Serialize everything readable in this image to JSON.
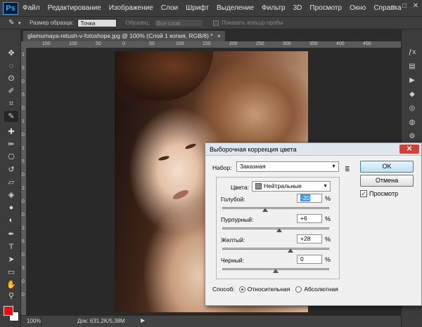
{
  "app": {
    "logo": "Ps"
  },
  "menu": [
    "Файл",
    "Редактирование",
    "Изображение",
    "Слои",
    "Шрифт",
    "Выделение",
    "Фильтр",
    "3D",
    "Просмотр",
    "Окно",
    "Справка"
  ],
  "window_controls": {
    "minimize": "–",
    "maximize": "□",
    "close": "✕"
  },
  "options_bar": {
    "tool_icon": "eyedropper-icon",
    "sample_size_label": "Размер образца:",
    "sample_size_value": "Точка",
    "sample_label": "Образец:",
    "sample_value": "Все слои",
    "show_ring_label": "Показать кольцо пробы"
  },
  "document": {
    "tab_title": "glamurnaya-retush-v-fotoshope.jpg @ 100% (Слой 1 копия, RGB/8) *",
    "tab_close": "×"
  },
  "ruler": {
    "h_ticks": [
      "150",
      "100",
      "50",
      "0",
      "50",
      "100",
      "150",
      "200",
      "250",
      "300",
      "350",
      "400",
      "450"
    ],
    "v_ticks": [
      "1",
      "5",
      "0",
      "5",
      "0",
      "1",
      "0",
      "1",
      "5",
      "0",
      "2",
      "0",
      "0",
      "2",
      "5",
      "0",
      "3",
      "0",
      "0"
    ]
  },
  "status_bar": {
    "zoom": "100%",
    "doc_info": "Док: 631,2K/5,38M",
    "arrow": "▶"
  },
  "colors": {
    "foreground": "#e21111",
    "background": "#ffffff",
    "accent": "#31a8ff"
  },
  "dialog": {
    "title": "Выборочная коррекция цвета",
    "close_label": "✕",
    "preset_label": "Набор:",
    "preset_value": "Заказная",
    "ok_label": "OK",
    "cancel_label": "Отмена",
    "preview_label": "Просмотр",
    "preview_checked": true,
    "colors_label": "Цвета:",
    "colors_value": "Нейтральные",
    "percent_sign": "%",
    "sliders": [
      {
        "label": "Голубой:",
        "value": "-20",
        "level": -20,
        "selected": true
      },
      {
        "label": "Пурпурный:",
        "value": "+6",
        "level": 6,
        "selected": false
      },
      {
        "label": "Желтый:",
        "value": "+28",
        "level": 28,
        "selected": false
      },
      {
        "label": "Черный:",
        "value": "0",
        "level": 0,
        "selected": false
      }
    ],
    "method_label": "Способ:",
    "method_relative": "Относительная",
    "method_absolute": "Абсолютная",
    "method_selected": "relative"
  }
}
